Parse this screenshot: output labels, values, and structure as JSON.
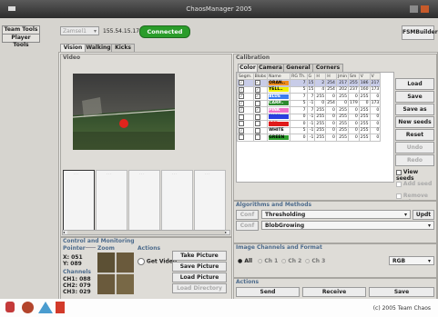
{
  "window": {
    "title": "ChaosManager 2005"
  },
  "tools": {
    "team": "Team Tools",
    "player": "Player Tools"
  },
  "toolbar": {
    "combo_value": "Zamsel1",
    "ip": "155.54.15.178",
    "status": "Connected",
    "fsm_builder": "FSMBuilder"
  },
  "main_tabs": [
    "Vision",
    "Walking",
    "Kicks"
  ],
  "video": {
    "title": "Video"
  },
  "control": {
    "title": "Control and Monitoring",
    "pointer_label": "Pointer",
    "zoom_label": "Zoom",
    "actions_label": "Actions",
    "x": "X: 051",
    "y": "Y: 089",
    "channels_label": "Channels",
    "ch1": "CH1: 088",
    "ch2": "CH2: 079",
    "ch3": "CH3: 029",
    "get_video": "Get Video",
    "take_picture": "Take Picture",
    "save_picture": "Save Picture",
    "load_picture": "Load Picture",
    "load_directory": "Load Directory"
  },
  "calibration": {
    "title": "Calibration",
    "tabs": [
      "Color",
      "Camera",
      "General",
      "Corners"
    ],
    "headers": [
      "Segm.",
      "Blobs",
      "Name",
      "RG Th.",
      "G",
      "H",
      "H",
      "Jmin",
      "Sm",
      "V",
      "V"
    ],
    "rows": [
      {
        "seg": true,
        "blob": true,
        "name": "ORAN..",
        "color": "#f08c1e",
        "text": "#000",
        "vals": [
          "7",
          "15",
          "2",
          "254",
          "217",
          "255",
          "186",
          "217"
        ],
        "sel": true
      },
      {
        "seg": true,
        "blob": true,
        "name": "YELL..",
        "color": "#f0f000",
        "text": "#000",
        "vals": [
          "5",
          "15",
          "4",
          "254",
          "202",
          "237",
          "160",
          "173"
        ],
        "sel": false
      },
      {
        "seg": true,
        "blob": true,
        "name": "BLUE",
        "color": "#3c7cf0",
        "text": "#fff",
        "vals": [
          "7",
          "7",
          "255",
          "0",
          "255",
          "0",
          "255",
          "0"
        ],
        "sel": false
      },
      {
        "seg": true,
        "blob": false,
        "name": "CARP..",
        "color": "#2e8a2e",
        "text": "#fff",
        "vals": [
          "5",
          "-1",
          "0",
          "254",
          "0",
          "179",
          "0",
          "173"
        ],
        "sel": false
      },
      {
        "seg": true,
        "blob": true,
        "name": "PINK",
        "color": "#f070c8",
        "text": "#fff",
        "vals": [
          "7",
          "7",
          "255",
          "0",
          "255",
          "0",
          "255",
          "0"
        ],
        "sel": false
      },
      {
        "seg": false,
        "blob": false,
        "name": "CIAN..",
        "color": "#2a3ee0",
        "text": "#2a3ee0",
        "vals": [
          "0",
          "-1",
          "255",
          "0",
          "255",
          "0",
          "255",
          "0"
        ],
        "sel": false
      },
      {
        "seg": false,
        "blob": false,
        "name": "RED",
        "color": "#e01a1a",
        "text": "#e01a1a",
        "vals": [
          "0",
          "-1",
          "255",
          "0",
          "255",
          "0",
          "255",
          "0"
        ],
        "sel": false
      },
      {
        "seg": true,
        "blob": false,
        "name": "WHITE",
        "color": "#ffffff",
        "text": "#000",
        "vals": [
          "5",
          "-1",
          "255",
          "0",
          "255",
          "0",
          "255",
          "0"
        ],
        "sel": false
      },
      {
        "seg": false,
        "blob": false,
        "name": "GREEN",
        "color": "#2ea02e",
        "text": "#000",
        "vals": [
          "0",
          "-1",
          "255",
          "0",
          "255",
          "0",
          "255",
          "0"
        ],
        "sel": false
      }
    ],
    "buttons": {
      "load": "Load",
      "save": "Save",
      "save_as": "Save as",
      "new_seeds": "New seeds",
      "reset_seeds": "Reset Seeds",
      "undo": "Undo",
      "redo": "Redo"
    },
    "checks": {
      "view_seeds": "View seeds",
      "add_seed": "Add seed",
      "remove_seed": "Remove seed"
    }
  },
  "algorithms": {
    "title": "Algorithms and Methods",
    "conf": "Conf",
    "method1": "Thresholding",
    "method2": "BlobGrowing",
    "updt": "Updt"
  },
  "image_channels": {
    "title": "Image Channels and Format",
    "all": "All",
    "ch1": "Ch 1",
    "ch2": "Ch 2",
    "ch3": "Ch 3",
    "format": "RGB"
  },
  "actions": {
    "title": "Actions",
    "send": "Send",
    "receive": "Receive",
    "save": "Save"
  },
  "footer": {
    "copyright": "(c) 2005 Team Chaos"
  }
}
